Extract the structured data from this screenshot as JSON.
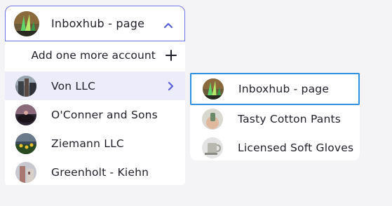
{
  "selector": {
    "current_label": "Inboxhub - page",
    "accent_color": "#6f74e6"
  },
  "dropdown": {
    "add_label": "Add one more account",
    "accounts": [
      {
        "label": "Von LLC",
        "active": true,
        "avatar": "city-building-avatar"
      },
      {
        "label": "O'Conner and Sons",
        "avatar": "sunset-silhouette-avatar"
      },
      {
        "label": "Ziemann LLC",
        "avatar": "sunflower-field-avatar"
      },
      {
        "label": "Greenholt - Kiehn",
        "avatar": "stone-tower-avatar"
      }
    ]
  },
  "submenu": {
    "pages": [
      {
        "label": "Inboxhub - page",
        "selected": true,
        "avatar": "aurora-avatar"
      },
      {
        "label": "Tasty Cotton Pants",
        "avatar": "hand-holding-cup-avatar"
      },
      {
        "label": "Licensed Soft Gloves",
        "avatar": "mug-avatar"
      }
    ],
    "selected_border_color": "#2f8fe0"
  }
}
